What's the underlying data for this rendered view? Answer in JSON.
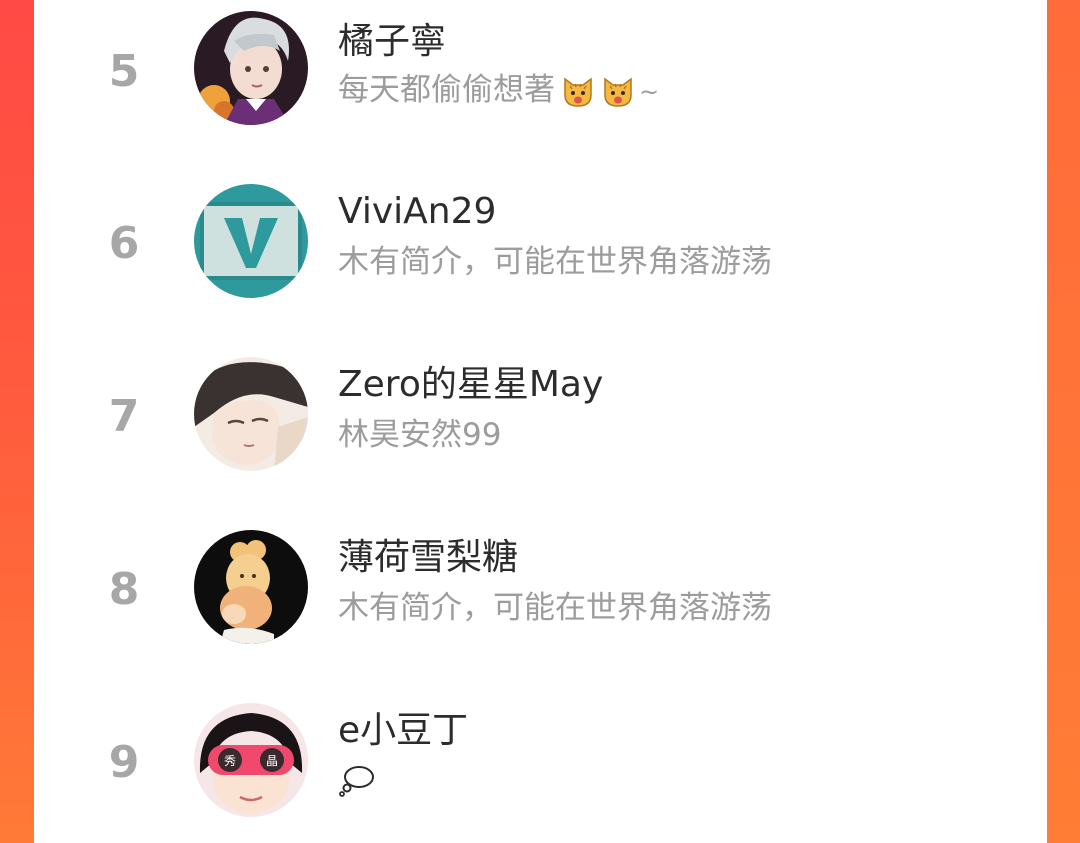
{
  "entries": [
    {
      "rank": "5",
      "name": "橘子寧",
      "desc_text": "每天都偷偷想著",
      "desc_tail": "~",
      "emoji": [
        "cat-face-emoji",
        "cat-face-emoji"
      ]
    },
    {
      "rank": "6",
      "name": "ViviAn29",
      "desc_text": "木有简介，可能在世界角落游荡"
    },
    {
      "rank": "7",
      "name": "Zero的星星May",
      "desc_text": "林昊安然99"
    },
    {
      "rank": "8",
      "name": "薄荷雪梨糖",
      "desc_text": "木有简介，可能在世界角落游荡"
    },
    {
      "rank": "9",
      "name": "e小豆丁",
      "desc_icon": "thought-bubble-icon",
      "avatar_badges": [
        "秀",
        "晶"
      ]
    }
  ],
  "colors": {
    "background_top": "#ff4a45",
    "background_bottom": "#ff7a37",
    "panel": "#ffffff",
    "rank_text": "#a7a7a7",
    "name_text": "#2c2c2c",
    "desc_text": "#9c9c9c"
  }
}
